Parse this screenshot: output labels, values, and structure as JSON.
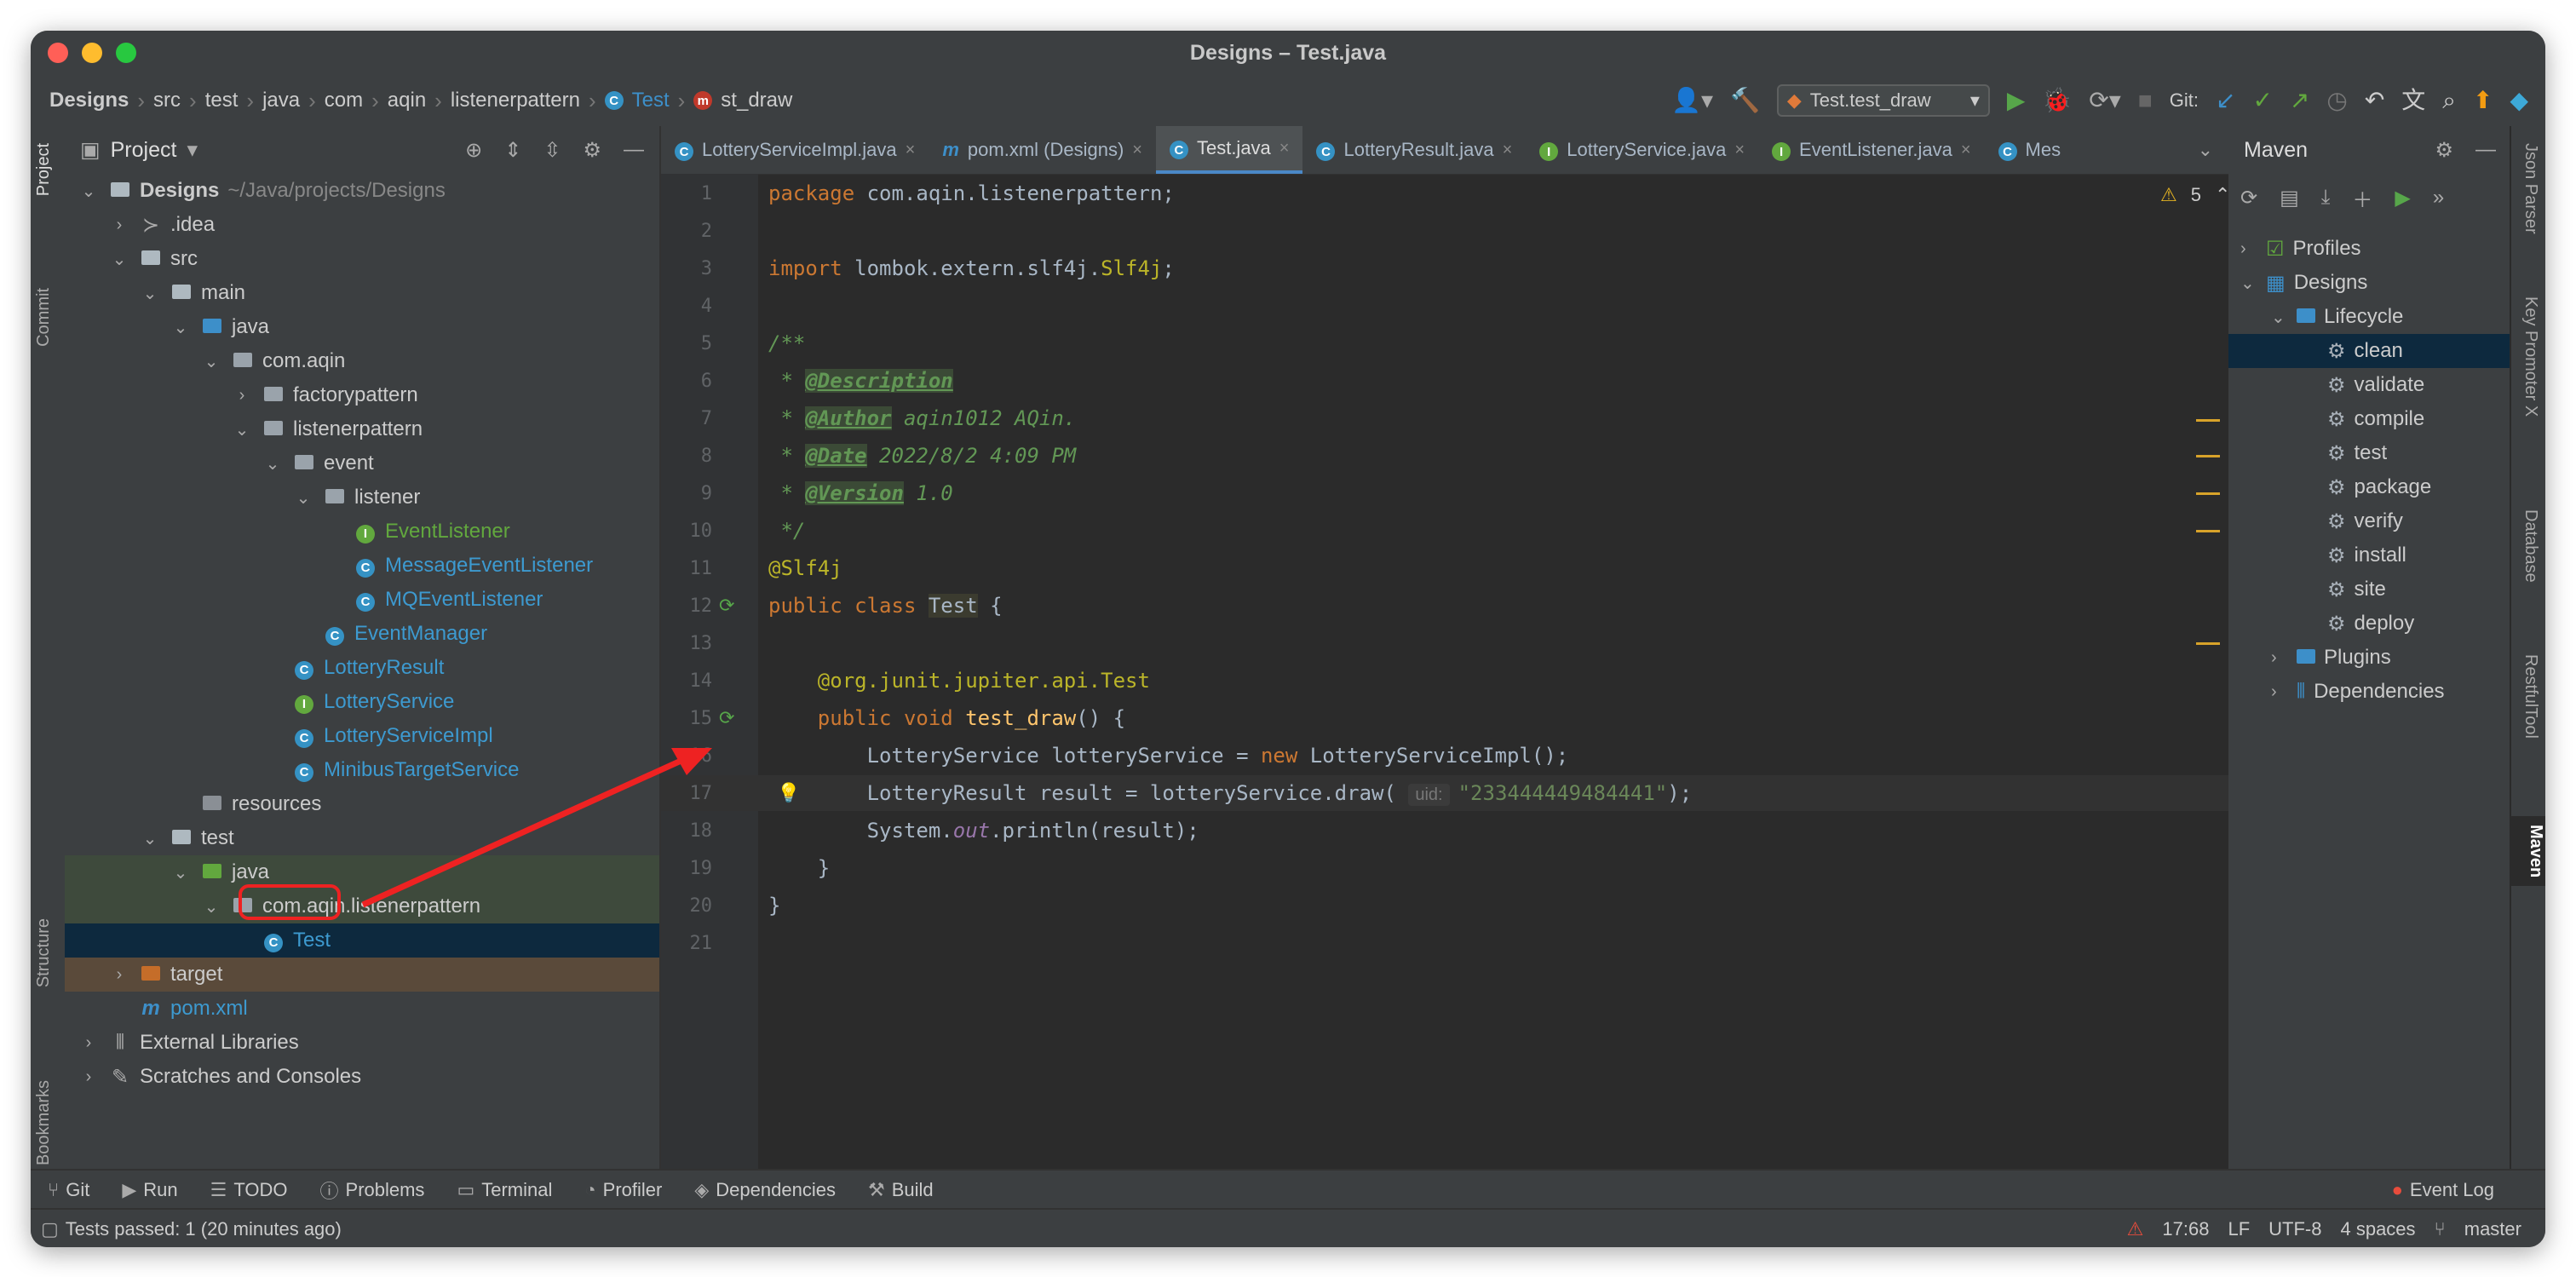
{
  "window": {
    "title": "Designs – Test.java"
  },
  "breadcrumb": [
    "Designs",
    "src",
    "test",
    "java",
    "com",
    "aqin",
    "listenerpattern",
    "Test",
    "st_draw"
  ],
  "toolbar": {
    "run_config": "Test.test_draw",
    "git_label": "Git:"
  },
  "left_strip": [
    "Project",
    "Commit",
    "Structure",
    "Bookmarks"
  ],
  "right_strip": [
    "Json Parser",
    "Key Promoter X",
    "Database",
    "RestfulTool",
    "Maven"
  ],
  "project": {
    "title": "Project",
    "tree": [
      {
        "label": "Designs",
        "suffix": "~/Java/projects/Designs",
        "depth": 0,
        "icon": "folder",
        "open": "v"
      },
      {
        "label": ".idea",
        "depth": 1,
        "icon": "idea",
        "open": ">"
      },
      {
        "label": "src",
        "depth": 1,
        "icon": "folder",
        "open": "v"
      },
      {
        "label": "main",
        "depth": 2,
        "icon": "folder",
        "open": "v"
      },
      {
        "label": "java",
        "depth": 3,
        "icon": "folder-blue",
        "open": "v"
      },
      {
        "label": "com.aqin",
        "depth": 4,
        "icon": "package",
        "open": "v"
      },
      {
        "label": "factorypattern",
        "depth": 5,
        "icon": "package",
        "open": ">"
      },
      {
        "label": "listenerpattern",
        "depth": 5,
        "icon": "package",
        "open": "v"
      },
      {
        "label": "event",
        "depth": 6,
        "icon": "package",
        "open": "v"
      },
      {
        "label": "listener",
        "depth": 7,
        "icon": "package",
        "open": "v"
      },
      {
        "label": "EventListener",
        "depth": 8,
        "icon": "interface",
        "open": ""
      },
      {
        "label": "MessageEventListener",
        "depth": 8,
        "icon": "class",
        "open": ""
      },
      {
        "label": "MQEventListener",
        "depth": 8,
        "icon": "class",
        "open": ""
      },
      {
        "label": "EventManager",
        "depth": 7,
        "icon": "class",
        "open": ""
      },
      {
        "label": "LotteryResult",
        "depth": 6,
        "icon": "class",
        "open": ""
      },
      {
        "label": "LotteryService",
        "depth": 6,
        "icon": "interface",
        "open": ""
      },
      {
        "label": "LotteryServiceImpl",
        "depth": 6,
        "icon": "class",
        "open": ""
      },
      {
        "label": "MinibusTargetService",
        "depth": 6,
        "icon": "class",
        "open": ""
      },
      {
        "label": "resources",
        "depth": 3,
        "icon": "resources",
        "open": ""
      },
      {
        "label": "test",
        "depth": 2,
        "icon": "folder",
        "open": "v"
      },
      {
        "label": "java",
        "depth": 3,
        "icon": "folder-green",
        "open": "v"
      },
      {
        "label": "com.aqin.listenerpattern",
        "depth": 4,
        "icon": "package",
        "open": "v"
      },
      {
        "label": "Test",
        "depth": 5,
        "icon": "class",
        "open": ""
      },
      {
        "label": "target",
        "depth": 1,
        "icon": "folder-orange",
        "open": ">"
      },
      {
        "label": "pom.xml",
        "depth": 1,
        "icon": "maven",
        "open": ""
      },
      {
        "label": "External Libraries",
        "depth": 0,
        "icon": "libraries",
        "open": ">"
      },
      {
        "label": "Scratches and Consoles",
        "depth": 0,
        "icon": "scratches",
        "open": ">"
      }
    ]
  },
  "tabs": [
    {
      "label": "LotteryServiceImpl.java",
      "icon": "class"
    },
    {
      "label": "pom.xml (Designs)",
      "icon": "maven"
    },
    {
      "label": "Test.java",
      "icon": "class",
      "active": true
    },
    {
      "label": "LotteryResult.java",
      "icon": "class"
    },
    {
      "label": "LotteryService.java",
      "icon": "interface"
    },
    {
      "label": "EventListener.java",
      "icon": "interface"
    },
    {
      "label": "Mes",
      "icon": "class"
    }
  ],
  "editor": {
    "warnings": "5",
    "lines": [
      {
        "n": "1",
        "html": "<span class='kw'>package</span> com.aqin.listenerpattern;"
      },
      {
        "n": "2",
        "html": ""
      },
      {
        "n": "3",
        "html": "<span class='kw'>import</span> lombok.extern.slf4j.<span class='ann'>Slf4j</span>;"
      },
      {
        "n": "4",
        "html": ""
      },
      {
        "n": "5",
        "html": "<span class='cm'>/**</span>"
      },
      {
        "n": "6",
        "html": "<span class='cm'> * </span><span class='tag'>@Description</span>"
      },
      {
        "n": "7",
        "html": "<span class='cm'> * </span><span class='tag'>@Author</span><span class='cm'> aqin1012 AQin.</span>"
      },
      {
        "n": "8",
        "html": "<span class='cm'> * </span><span class='tag'>@Date</span><span class='cm'> 2022/8/2 4:09 PM</span>"
      },
      {
        "n": "9",
        "html": "<span class='cm'> * </span><span class='tag'>@Version</span><span class='cm'> 1.0</span>"
      },
      {
        "n": "10",
        "html": "<span class='cm'> */</span>"
      },
      {
        "n": "11",
        "html": "<span class='ann'>@Slf4j</span>"
      },
      {
        "n": "12",
        "html": "<span class='kw'>public class</span> <span style='background:#3b3b2f'>Test</span> {"
      },
      {
        "n": "13",
        "html": ""
      },
      {
        "n": "14",
        "html": "    <span class='ann'>@org.junit.jupiter.api.Test</span>"
      },
      {
        "n": "15",
        "html": "    <span class='kw'>public void</span> <span class='fn'>test_draw</span>() {"
      },
      {
        "n": "16",
        "html": "        LotteryService lotteryService = <span class='kw'>new</span> LotteryServiceImpl();"
      },
      {
        "n": "17",
        "html": "        LotteryResult result = lotteryService.draw( <span class='hint'>uid:</span><span class='str'>\"233444449484441\"</span>);"
      },
      {
        "n": "18",
        "html": "        System.<i style='color:#9876aa'>out</i>.println(result);"
      },
      {
        "n": "19",
        "html": "    }"
      },
      {
        "n": "20",
        "html": "}"
      },
      {
        "n": "21",
        "html": ""
      }
    ]
  },
  "maven": {
    "title": "Maven",
    "tree": [
      {
        "label": "Profiles",
        "depth": 0,
        "open": ">",
        "icon": "profiles"
      },
      {
        "label": "Designs",
        "depth": 0,
        "open": "v",
        "icon": "maven-project"
      },
      {
        "label": "Lifecycle",
        "depth": 1,
        "open": "v",
        "icon": "folder"
      },
      {
        "label": "clean",
        "depth": 2,
        "open": "",
        "icon": "gear",
        "selected": true
      },
      {
        "label": "validate",
        "depth": 2,
        "open": "",
        "icon": "gear"
      },
      {
        "label": "compile",
        "depth": 2,
        "open": "",
        "icon": "gear"
      },
      {
        "label": "test",
        "depth": 2,
        "open": "",
        "icon": "gear"
      },
      {
        "label": "package",
        "depth": 2,
        "open": "",
        "icon": "gear"
      },
      {
        "label": "verify",
        "depth": 2,
        "open": "",
        "icon": "gear"
      },
      {
        "label": "install",
        "depth": 2,
        "open": "",
        "icon": "gear"
      },
      {
        "label": "site",
        "depth": 2,
        "open": "",
        "icon": "gear"
      },
      {
        "label": "deploy",
        "depth": 2,
        "open": "",
        "icon": "gear"
      },
      {
        "label": "Plugins",
        "depth": 1,
        "open": ">",
        "icon": "folder"
      },
      {
        "label": "Dependencies",
        "depth": 1,
        "open": ">",
        "icon": "libraries"
      }
    ]
  },
  "bottom_tools": [
    {
      "label": "Git",
      "icon": "git-icon"
    },
    {
      "label": "Run",
      "icon": "run-icon"
    },
    {
      "label": "TODO",
      "icon": "todo-icon"
    },
    {
      "label": "Problems",
      "icon": "problems-icon"
    },
    {
      "label": "Terminal",
      "icon": "terminal-icon"
    },
    {
      "label": "Profiler",
      "icon": "profiler-icon"
    },
    {
      "label": "Dependencies",
      "icon": "dependencies-icon"
    },
    {
      "label": "Build",
      "icon": "build-icon"
    }
  ],
  "status": {
    "message": "Tests passed: 1 (20 minutes ago)",
    "position": "17:68",
    "line_sep": "LF",
    "encoding": "UTF-8",
    "indent": "4 spaces",
    "branch": "master",
    "event_log": "Event Log"
  },
  "colors": {
    "accent": "#4a88c7",
    "highlight_red": "#ee2222",
    "selection": "#0d293e"
  }
}
